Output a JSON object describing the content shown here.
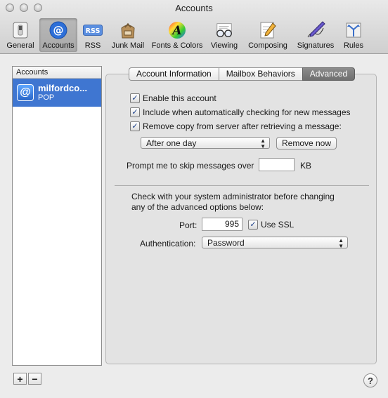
{
  "window": {
    "title": "Accounts"
  },
  "toolbar": {
    "items": [
      {
        "label": "General",
        "icon": "switch-icon"
      },
      {
        "label": "Accounts",
        "icon": "at-sign-icon",
        "selected": true
      },
      {
        "label": "RSS",
        "icon": "rss-icon"
      },
      {
        "label": "Junk Mail",
        "icon": "junk-bag-icon"
      },
      {
        "label": "Fonts & Colors",
        "icon": "font-colors-icon"
      },
      {
        "label": "Viewing",
        "icon": "glasses-icon"
      },
      {
        "label": "Composing",
        "icon": "pencil-paper-icon"
      },
      {
        "label": "Signatures",
        "icon": "pen-icon"
      },
      {
        "label": "Rules",
        "icon": "rules-icon"
      }
    ]
  },
  "accounts": {
    "header": "Accounts",
    "items": [
      {
        "name": "milfordco...",
        "type": "POP",
        "selected": true
      }
    ]
  },
  "tabs": [
    {
      "label": "Account Information"
    },
    {
      "label": "Mailbox Behaviors"
    },
    {
      "label": "Advanced",
      "active": true
    }
  ],
  "advanced": {
    "enable_account": {
      "label": "Enable this account",
      "checked": true
    },
    "include_check": {
      "label": "Include when automatically checking for new messages",
      "checked": true
    },
    "remove_copy": {
      "label": "Remove copy from server after retrieving a message:",
      "checked": true
    },
    "remove_after": "After one day",
    "remove_now": "Remove now",
    "skip_prompt": "Prompt me to skip messages over",
    "skip_value": "",
    "skip_unit": "KB",
    "admin_note_1": "Check with your system administrator before changing",
    "admin_note_2": "any of the advanced options below:",
    "port_label": "Port:",
    "port_value": "995",
    "use_ssl": {
      "label": "Use SSL",
      "checked": true
    },
    "auth_label": "Authentication:",
    "auth_value": "Password"
  },
  "footer": {
    "add": "+",
    "remove": "−",
    "help": "?"
  }
}
